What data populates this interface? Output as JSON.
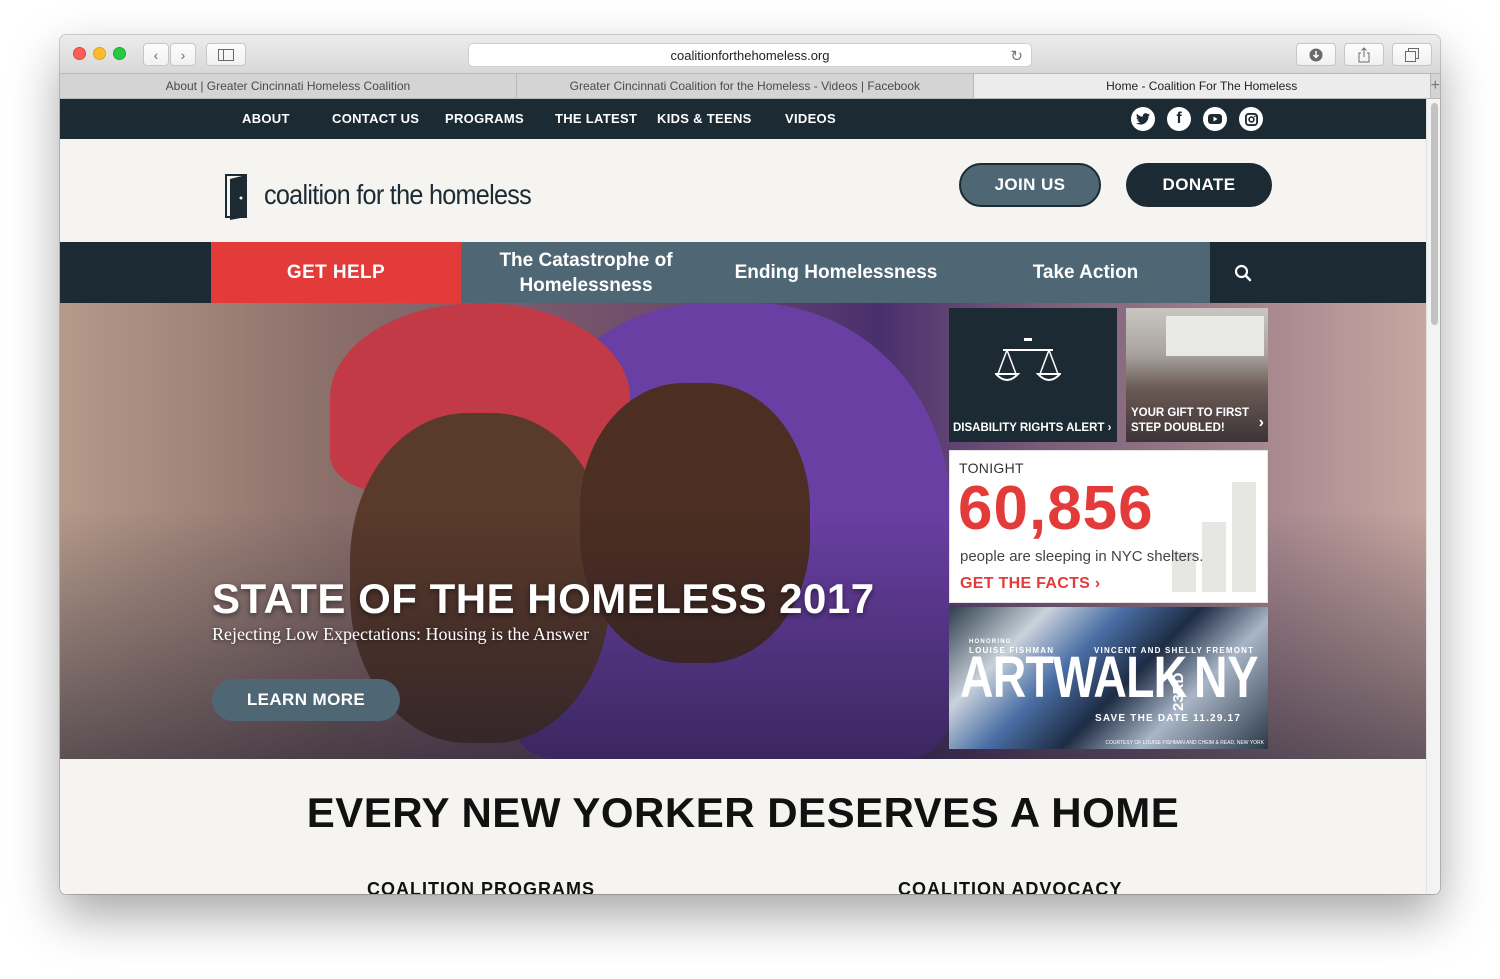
{
  "browser": {
    "url": "coalitionforthehomeless.org",
    "tabs": [
      {
        "label": "About | Greater Cincinnati Homeless Coalition",
        "active": false
      },
      {
        "label": "Greater Cincinnati Coalition for the Homeless - Videos | Facebook",
        "active": false
      },
      {
        "label": "Home - Coalition For The Homeless",
        "active": true
      }
    ],
    "new_tab": "+"
  },
  "topnav": {
    "items": [
      "ABOUT",
      "CONTACT US",
      "PROGRAMS",
      "THE LATEST",
      "KIDS & TEENS",
      "VIDEOS"
    ],
    "social": [
      "twitter-icon",
      "facebook-icon",
      "youtube-icon",
      "instagram-icon"
    ]
  },
  "header": {
    "logo_text": "coalition for the homeless",
    "join_label": "JOIN US",
    "donate_label": "DONATE"
  },
  "mainnav": {
    "get_help": "GET HELP",
    "catastrophe_line1": "The Catastrophe of",
    "catastrophe_line2": "Homelessness",
    "ending": "Ending Homelessness",
    "take_action": "Take Action",
    "search_icon": "search-icon"
  },
  "hero": {
    "title": "STATE OF THE HOMELESS 2017",
    "subtitle": "Rejecting Low Expectations: Housing is the Answer",
    "button": "LEARN MORE"
  },
  "tiles": {
    "disability": {
      "label": "DISABILITY RIGHTS ALERT",
      "arrow": "›"
    },
    "gift": {
      "line1": "YOUR GIFT TO FIRST",
      "line2": "STEP DOUBLED!",
      "arrow": "›"
    },
    "stat": {
      "tonight": "TONIGHT",
      "number": "60,856",
      "desc": "people are sleeping in NYC shelters.",
      "link": "GET THE FACTS ›"
    },
    "artwalk": {
      "honoring": "HONORING",
      "name1": "LOUISE FISHMAN",
      "name2": "VINCENT AND SHELLY FREMONT",
      "title": "ARTWALK",
      "street": "23RD",
      "city": "NY",
      "save": "SAVE THE DATE 11.29.17",
      "credit": "COURTESY OF LOUISE FISHMAN AND CHEIM & READ, NEW YORK"
    }
  },
  "section": {
    "headline": "EVERY NEW YORKER DESERVES A HOME",
    "col1": "COALITION PROGRAMS",
    "col2": "COALITION ADVOCACY"
  },
  "colors": {
    "navy": "#1c2a34",
    "slate": "#4f6775",
    "red": "#e33b3a",
    "cream": "#f5f4f0"
  }
}
